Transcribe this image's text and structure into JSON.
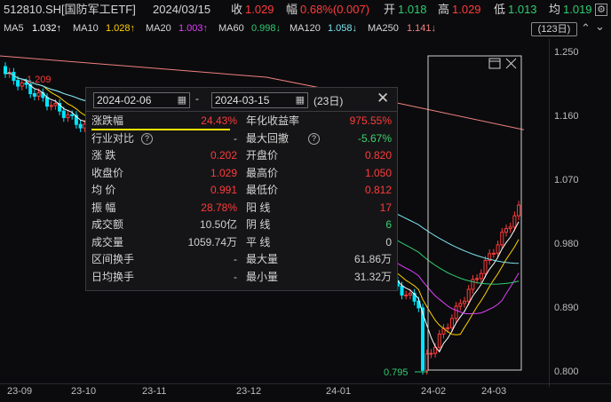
{
  "header": {
    "code": "512810.SH[国防军工ETF]",
    "date": "2024/03/15",
    "close_label": "收",
    "close_value": "1.029",
    "change_label": "幅",
    "change_value": "0.68%(0.007)",
    "open_label": "开",
    "open_value": "1.018",
    "high_label": "高",
    "high_value": "1.029",
    "low_label": "低",
    "low_value": "1.013",
    "avg_label": "均",
    "avg_value": "1.019"
  },
  "ma_row": {
    "ma5": "MA5",
    "ma5_value": "1.032↑",
    "ma10": "MA10",
    "ma10_value": "1.028↑",
    "ma20": "MA20",
    "ma20_value": "1.003↑",
    "ma60": "MA60",
    "ma60_value": "0.998↓",
    "ma120": "MA120",
    "ma120_value": "1.058↓",
    "ma250": "MA250",
    "ma250_value": "1.141↓",
    "period_badge": "(123日)"
  },
  "chart": {
    "y_ticks": [
      "1.250",
      "1.160",
      "1.070",
      "0.980",
      "0.890",
      "0.800"
    ],
    "x_ticks": [
      "23-09",
      "23-10",
      "23-11",
      "23-12",
      "24-01",
      "24-02",
      "24-03"
    ],
    "left_price_label": "1.209",
    "low_marker_label": "0.795",
    "colors": {
      "up": "#ff3b3b",
      "down": "#00e5ff",
      "ma5": "#ffffff",
      "ma10": "#ffd200",
      "ma20": "#e040fb",
      "ma60": "#2ecc71",
      "ma120": "#7fe3f0",
      "ma250": "#f08080"
    }
  },
  "popup": {
    "start_date": "2024-02-06",
    "sep": "-",
    "end_date": "2024-03-15",
    "days": "(23日)",
    "left_rows": [
      {
        "label": "涨跌幅",
        "value": "24.43%",
        "color": "rd"
      },
      {
        "label": "行业对比",
        "value": "-",
        "color": "gy"
      },
      {
        "label": "涨  跌",
        "value": "0.202",
        "color": "rd"
      },
      {
        "label": "收盘价",
        "value": "1.029",
        "color": "rd"
      },
      {
        "label": "均  价",
        "value": "0.991",
        "color": "rd"
      },
      {
        "label": "振  幅",
        "value": "28.78%",
        "color": "rd"
      },
      {
        "label": "成交额",
        "value": "10.50亿",
        "color": "gy"
      },
      {
        "label": "成交量",
        "value": "1059.74万",
        "color": "gy"
      },
      {
        "label": "区间换手",
        "value": "-",
        "color": "gy"
      },
      {
        "label": "日均换手",
        "value": "-",
        "color": "gy"
      }
    ],
    "right_rows": [
      {
        "label": "年化收益率",
        "value": "975.55%",
        "color": "rd"
      },
      {
        "label": "最大回撤",
        "value": "-5.67%",
        "color": "gr"
      },
      {
        "label": "开盘价",
        "value": "0.820",
        "color": "rd"
      },
      {
        "label": "最高价",
        "value": "1.050",
        "color": "rd"
      },
      {
        "label": "最低价",
        "value": "0.812",
        "color": "rd"
      },
      {
        "label": "阳  线",
        "value": "17",
        "color": "rd"
      },
      {
        "label": "阴  线",
        "value": "6",
        "color": "gr"
      },
      {
        "label": "平  线",
        "value": "0",
        "color": "gy"
      },
      {
        "label": "最大量",
        "value": "61.86万",
        "color": "gy"
      },
      {
        "label": "最小量",
        "value": "31.32万",
        "color": "gy"
      }
    ]
  }
}
